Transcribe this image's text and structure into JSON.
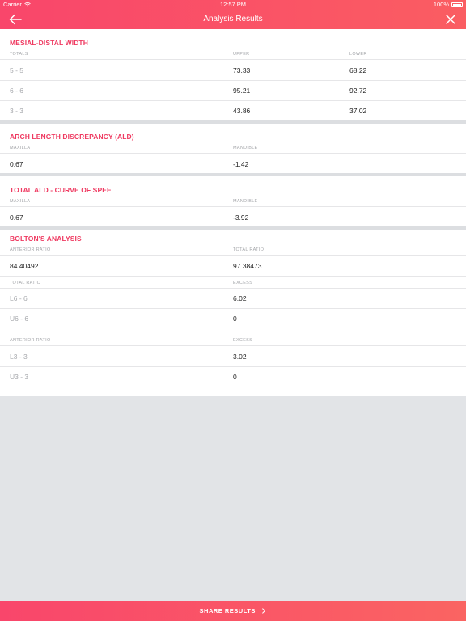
{
  "status_bar": {
    "carrier": "Carrier",
    "time": "12:57 PM",
    "battery": "100%"
  },
  "nav": {
    "title": "Analysis Results",
    "back_icon": "arrow-left-icon",
    "close_icon": "close-icon"
  },
  "mesial_distal": {
    "title": "MESIAL-DISTAL WIDTH",
    "headers": [
      "TOTALS",
      "UPPER",
      "LOWER"
    ],
    "rows": [
      {
        "label": "5 - 5",
        "upper": "73.33",
        "lower": "68.22"
      },
      {
        "label": "6 - 6",
        "upper": "95.21",
        "lower": "92.72"
      },
      {
        "label": "3 - 3",
        "upper": "43.86",
        "lower": "37.02"
      }
    ]
  },
  "ald": {
    "title": "ARCH LENGTH DISCREPANCY (ALD)",
    "headers": [
      "MAXILLA",
      "MANDIBLE"
    ],
    "values": [
      "0.67",
      "-1.42"
    ]
  },
  "total_ald": {
    "title": "TOTAL ALD - CURVE OF SPEE",
    "headers": [
      "MAXILLA",
      "MANDIBLE"
    ],
    "values": [
      "0.67",
      "-3.92"
    ]
  },
  "bolton": {
    "title": "BOLTON'S ANALYSIS",
    "headers": [
      "ANTERIOR RATIO",
      "TOTAL RATIO"
    ],
    "values": [
      "84.40492",
      "97.38473"
    ],
    "total_group": {
      "headers": [
        "TOTAL RATIO",
        "EXCESS"
      ],
      "rows": [
        {
          "label": "L6 - 6",
          "value": "6.02"
        },
        {
          "label": "U6 - 6",
          "value": "0"
        }
      ]
    },
    "anterior_group": {
      "headers": [
        "ANTERIOR RATIO",
        "EXCESS"
      ],
      "rows": [
        {
          "label": "L3 - 3",
          "value": "3.02"
        },
        {
          "label": "U3 - 3",
          "value": "0"
        }
      ]
    }
  },
  "share": {
    "label": "SHARE RESULTS",
    "icon": "chevron-right-icon"
  },
  "colors": {
    "accent": "#f9466b",
    "accent_end": "#fa6462",
    "title_red": "#ef3a61",
    "background": "#e2e4e7"
  }
}
